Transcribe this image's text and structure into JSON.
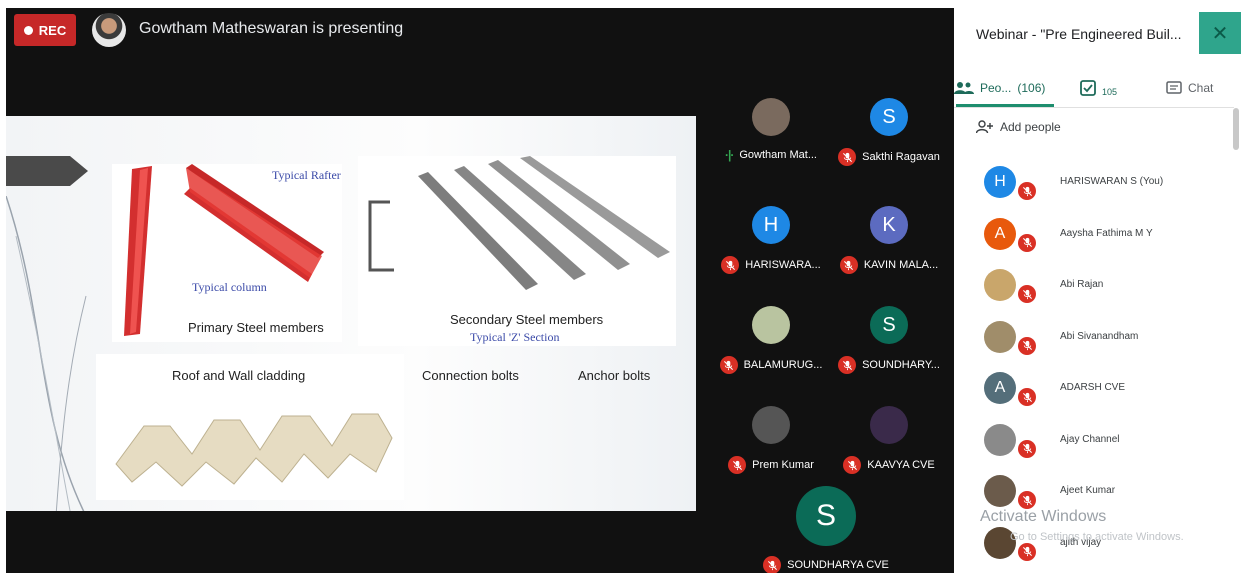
{
  "recording": {
    "label": "REC"
  },
  "presenting": {
    "text": "Gowtham Matheswaran is presenting"
  },
  "slide": {
    "typical_rafter": "Typical Rafter",
    "typical_column": "Typical column",
    "primary": "Primary Steel members",
    "secondary": "Secondary Steel members",
    "z_section": "Typical 'Z' Section",
    "roof": "Roof and Wall cladding",
    "bolts": "Connection bolts",
    "anchor": "Anchor bolts"
  },
  "tiles": [
    {
      "name": "Gowtham Mat...",
      "initial": "",
      "color": "#7a6a5e",
      "speaking": true
    },
    {
      "name": "Sakthi Ragavan",
      "initial": "S",
      "color": "#1e88e5",
      "speaking": false
    },
    {
      "name": "HARISWARA...",
      "initial": "H",
      "color": "#1e88e5",
      "speaking": false
    },
    {
      "name": "KAVIN MALA...",
      "initial": "K",
      "color": "#5c6bc0",
      "speaking": false
    },
    {
      "name": "BALAMURUG...",
      "initial": "",
      "color": "#b9c4a0",
      "speaking": false
    },
    {
      "name": "SOUNDHARY...",
      "initial": "S",
      "color": "#0b6b57",
      "speaking": false
    },
    {
      "name": "Prem Kumar",
      "initial": "",
      "color": "#555555",
      "speaking": false
    },
    {
      "name": "KAAVYA CVE",
      "initial": "",
      "color": "#3a2a4a",
      "speaking": false
    },
    {
      "name": "SOUNDHARYA CVE",
      "initial": "S",
      "color": "#0b6b57",
      "speaking": false
    }
  ],
  "sidebar": {
    "title": "Webinar - \"Pre Engineered Buil...",
    "close_icon": "✕",
    "tabs": {
      "people_label": "Peo...",
      "people_count": "(106)",
      "activities_count": "105",
      "chat_label": "Chat"
    },
    "add_people": "Add people",
    "people": [
      {
        "name": "HARISWARAN S (You)",
        "initial": "H",
        "color": "#1e88e5"
      },
      {
        "name": "Aaysha Fathima M Y",
        "initial": "A",
        "color": "#e8590c"
      },
      {
        "name": "Abi Rajan",
        "initial": "",
        "color": "#c9a66b"
      },
      {
        "name": "Abi Sivanandham",
        "initial": "",
        "color": "#a08d6a"
      },
      {
        "name": "ADARSH CVE",
        "initial": "A",
        "color": "#546e7a"
      },
      {
        "name": "Ajay Channel",
        "initial": "",
        "color": "#8a8a8a"
      },
      {
        "name": "Ajeet Kumar",
        "initial": "",
        "color": "#6b5b4b"
      },
      {
        "name": "ajith vijay",
        "initial": "",
        "color": "#5a4632"
      }
    ]
  },
  "watermark": {
    "title": "Activate Windows",
    "subtitle": "Go to Settings to activate Windows."
  }
}
